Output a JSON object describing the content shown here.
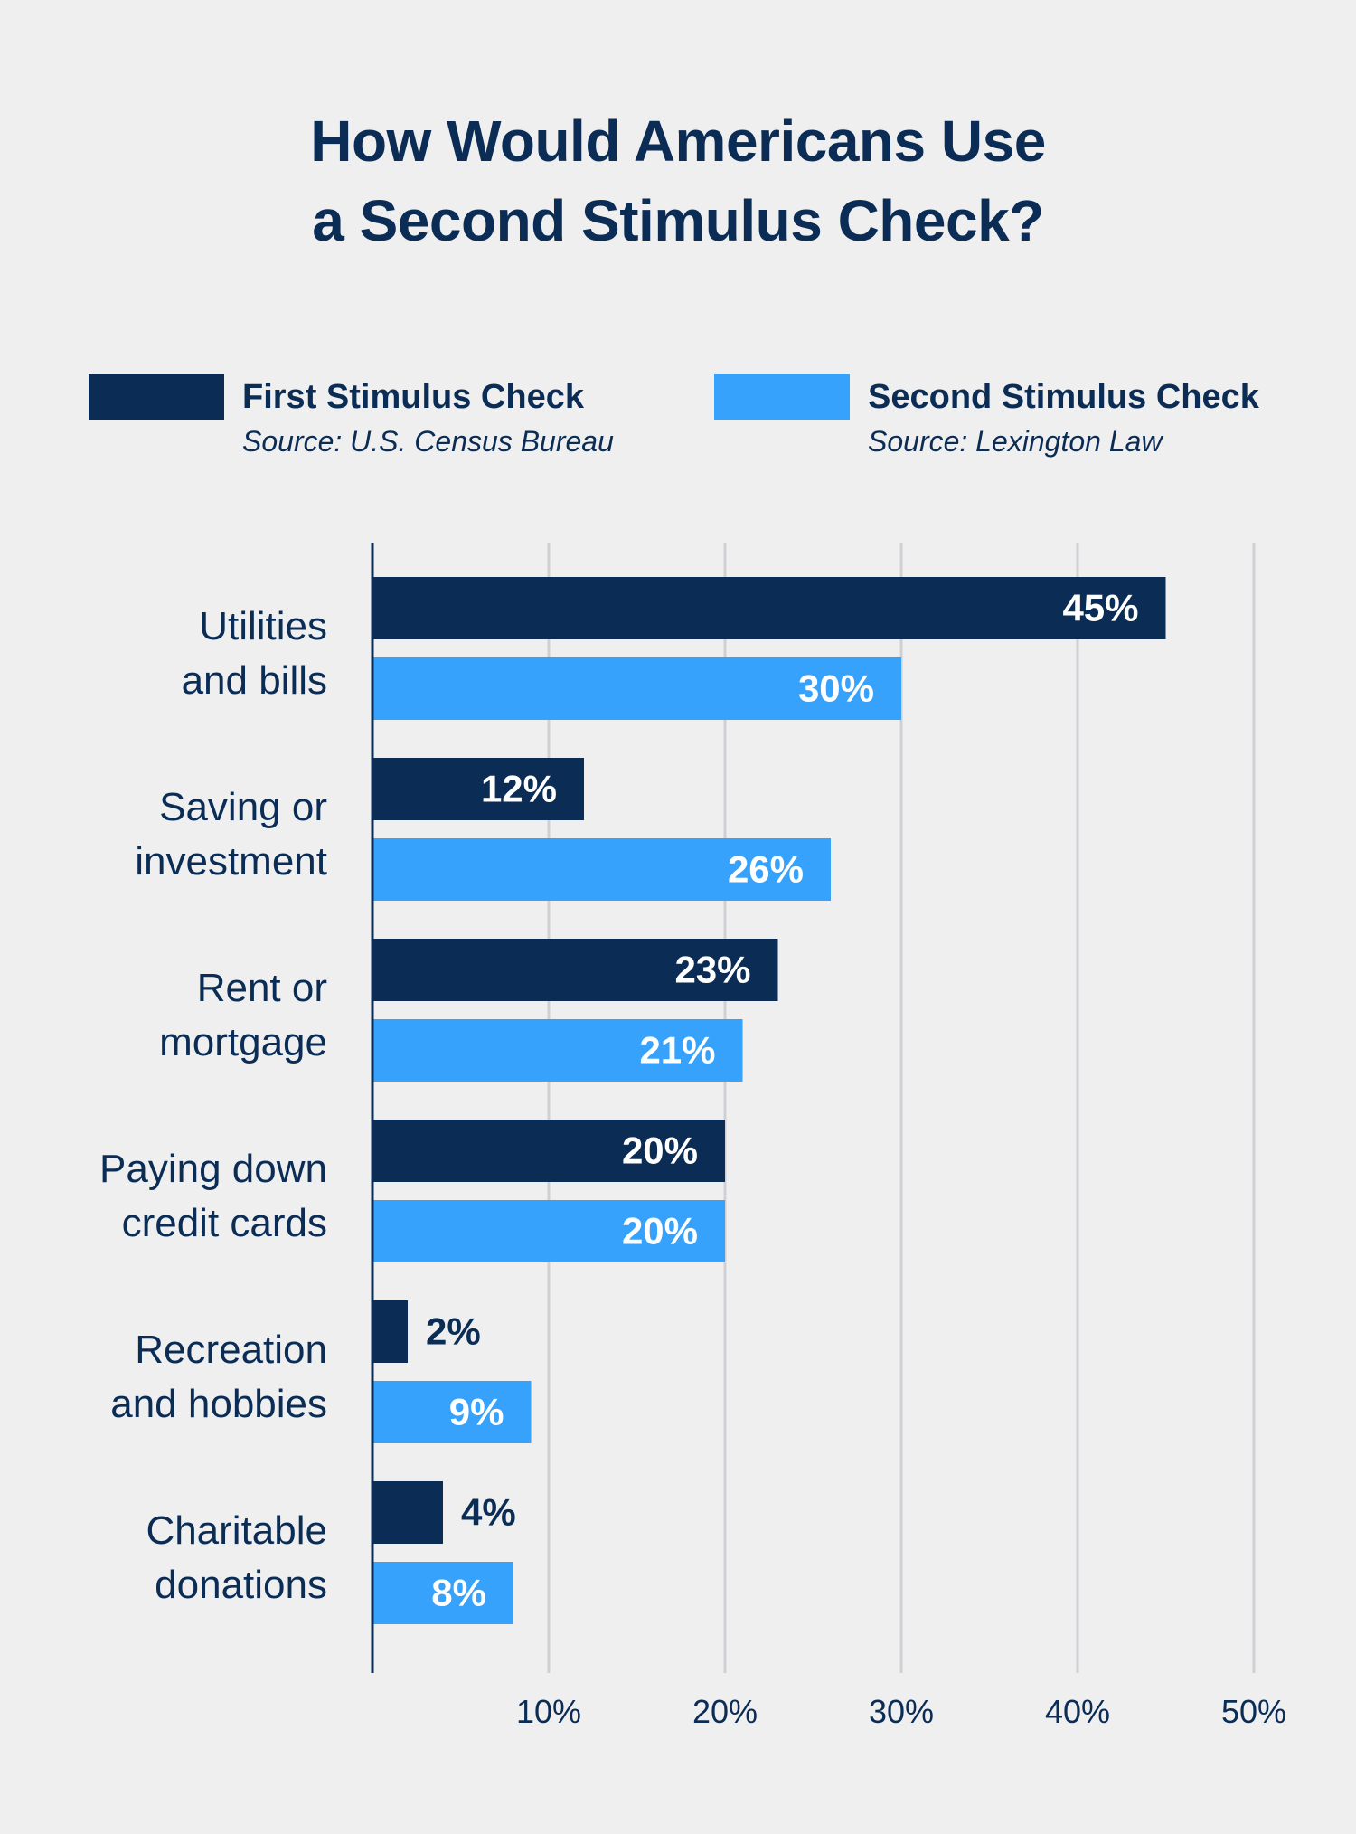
{
  "chart_data": {
    "type": "bar",
    "orientation": "horizontal",
    "title": "How Would Americans Use a Second Stimulus Check?",
    "title_lines": [
      "How Would Americans Use",
      "a Second Stimulus Check?"
    ],
    "categories": [
      [
        "Utilities",
        "and bills"
      ],
      [
        "Saving or",
        "investment"
      ],
      [
        "Rent or",
        "mortgage"
      ],
      [
        "Paying down",
        "credit cards"
      ],
      [
        "Recreation",
        "and hobbies"
      ],
      [
        "Charitable",
        "donations"
      ]
    ],
    "series": [
      {
        "name": "First Stimulus Check",
        "source": "Source: U.S. Census Bureau",
        "color": "#0b2d55",
        "values": [
          45,
          12,
          23,
          20,
          2,
          4
        ],
        "labels": [
          "45%",
          "12%",
          "23%",
          "20%",
          "2%",
          "4%"
        ]
      },
      {
        "name": "Second Stimulus Check",
        "source": "Source: Lexington Law",
        "color": "#36a2fc",
        "values": [
          30,
          26,
          21,
          20,
          9,
          8
        ],
        "labels": [
          "30%",
          "26%",
          "21%",
          "20%",
          "9%",
          "8%"
        ]
      }
    ],
    "xlim": [
      0,
      50
    ],
    "xticks": [
      10,
      20,
      30,
      40,
      50
    ],
    "xtick_labels": [
      "10%",
      "20%",
      "30%",
      "40%",
      "50%"
    ],
    "xlabel": "",
    "ylabel": "",
    "grid": true,
    "legend": "top"
  },
  "colors": {
    "text": "#0b2d55",
    "grid": "#d0d0d4",
    "axis": "#0b2d55",
    "background": "#efefef",
    "label_inside": "#ffffff"
  }
}
